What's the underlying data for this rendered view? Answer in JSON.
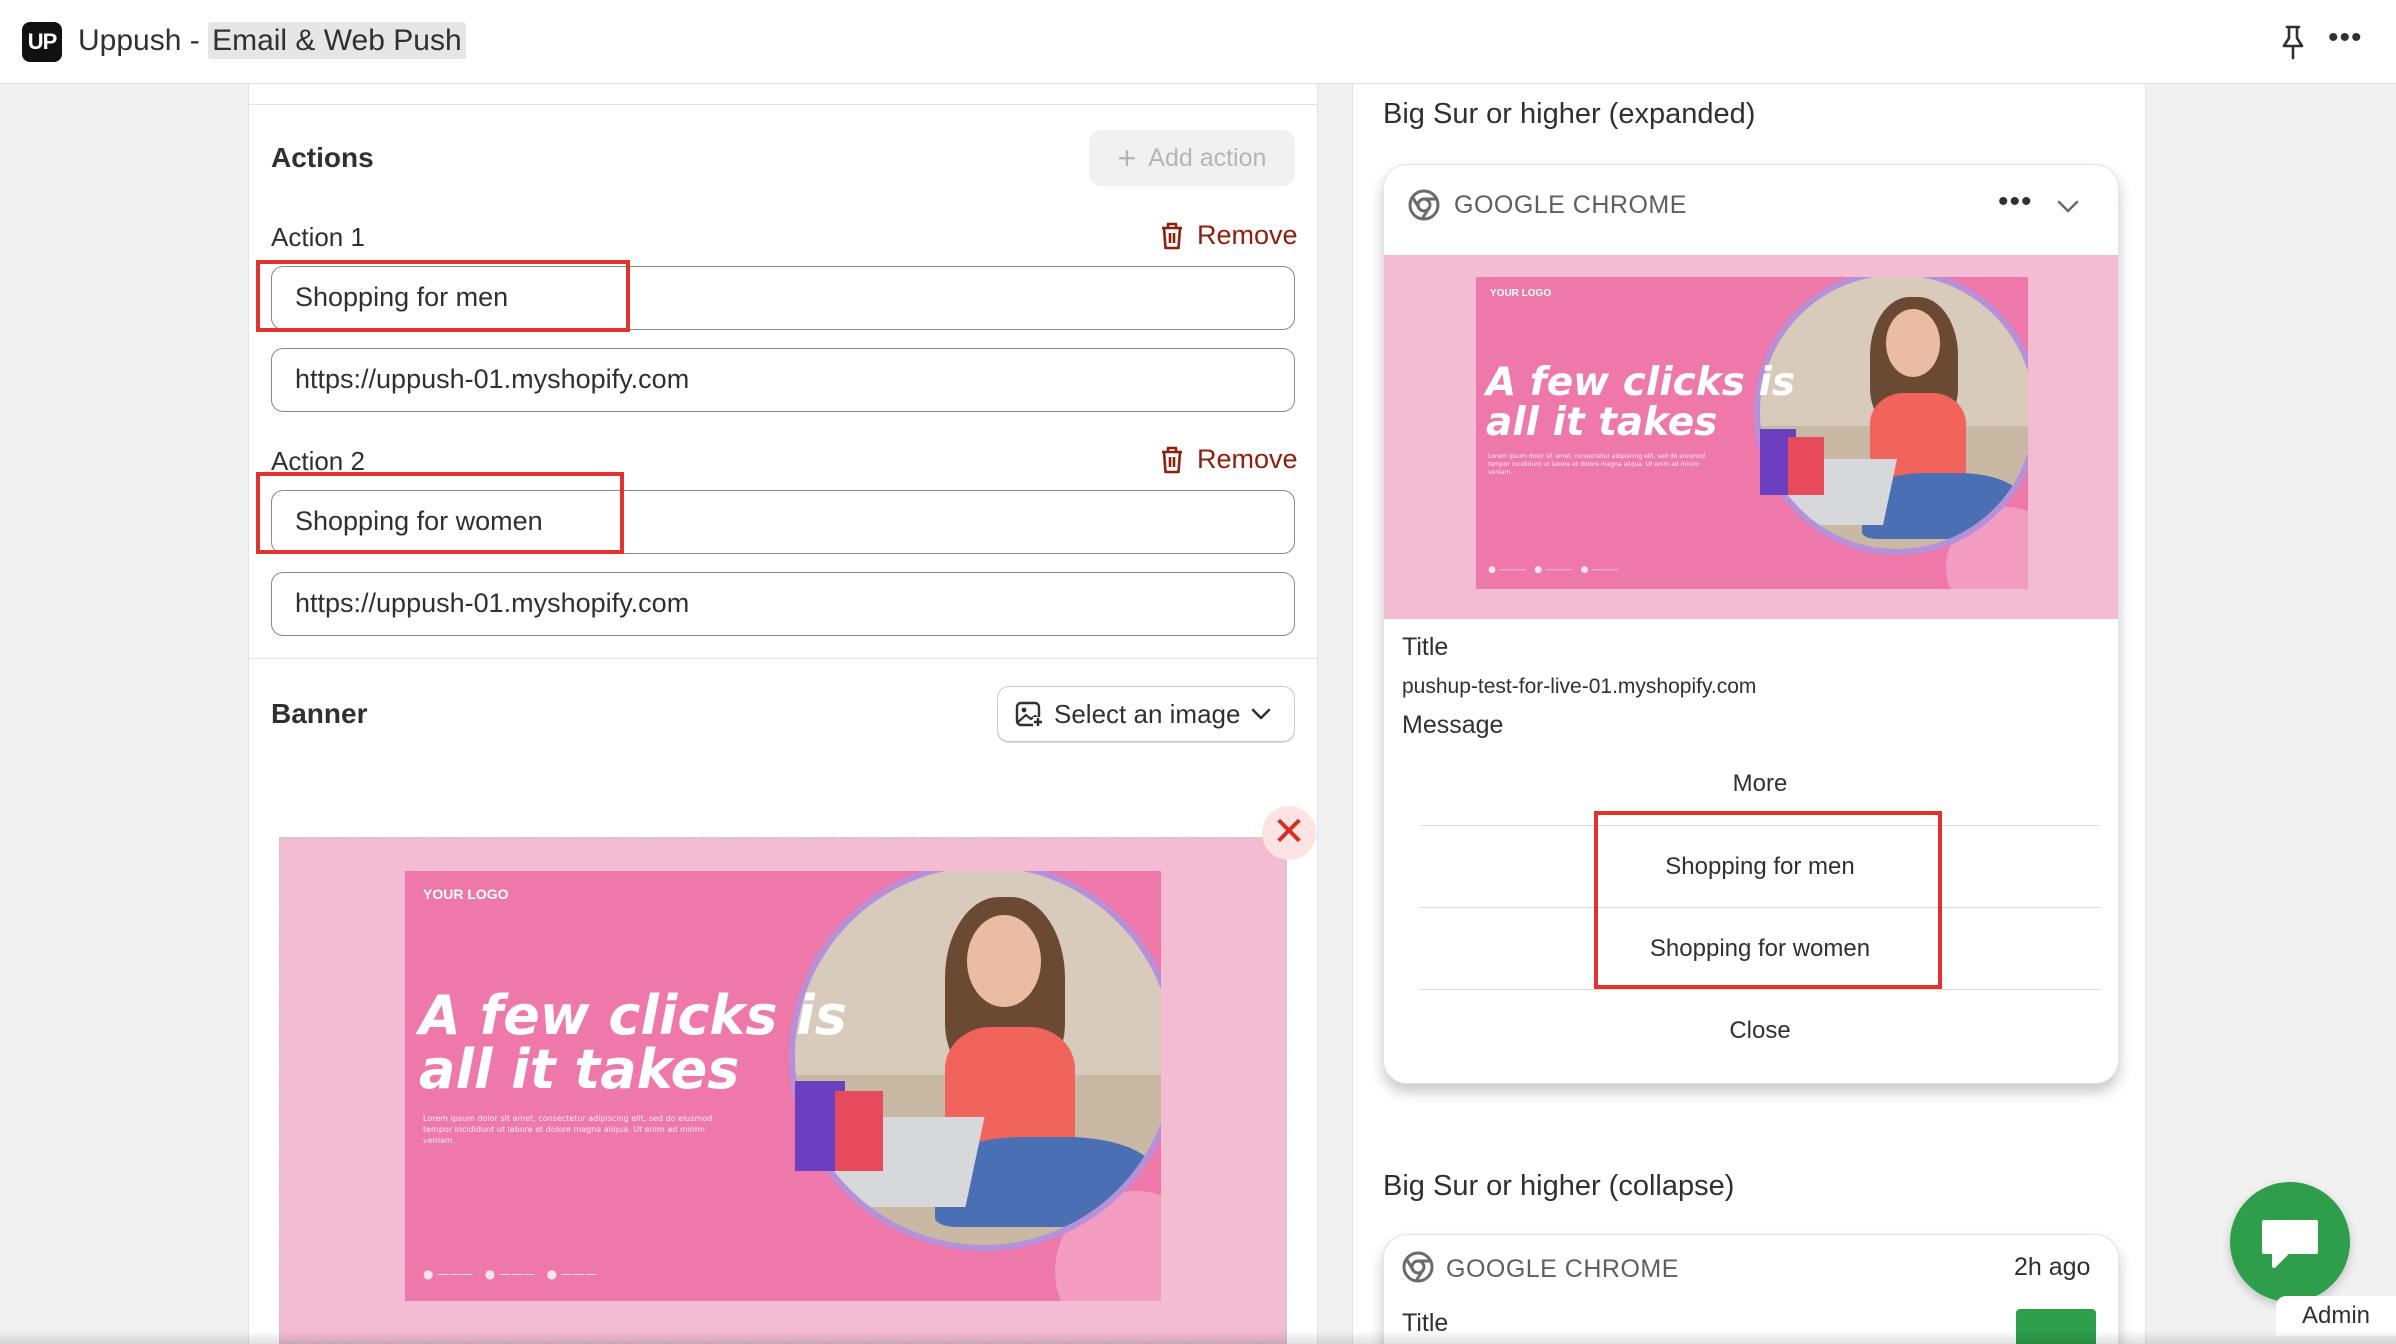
{
  "app": {
    "logo": "UP",
    "title": "Uppush",
    "separator": " - ",
    "subtitle": "Email & Web Push",
    "pin_icon": "pin-icon",
    "more_icon": "more-horizontal-icon",
    "more_glyph": "•••"
  },
  "actions": {
    "heading": "Actions",
    "add_button_label": "Add action",
    "add_icon": "+",
    "items": [
      {
        "label": "Action 1",
        "remove_label": "Remove",
        "title_value": "Shopping for men",
        "url_value": "https://uppush-01.myshopify.com"
      },
      {
        "label": "Action 2",
        "remove_label": "Remove",
        "title_value": "Shopping for women",
        "url_value": "https://uppush-01.myshopify.com"
      }
    ]
  },
  "banner": {
    "heading": "Banner",
    "select_label": "Select an image",
    "remove_glyph": "✕",
    "artwork": {
      "logo_text": "YOUR LOGO",
      "headline_line1": "A few clicks is",
      "headline_line2": "all it takes",
      "body_text": "Lorem ipsum dolor sit amet, consectetur adipiscing elit, sed do eiusmod tempor incididunt ut labore et dolore magna aliqua. Ut enim ad minim veniam."
    }
  },
  "preview_expanded": {
    "heading": "Big Sur or higher (expanded)",
    "browser": "GOOGLE CHROME",
    "dots_glyph": "•••",
    "title": "Title",
    "site": "pushup-test-for-live-01.myshopify.com",
    "message": "Message",
    "more": "More",
    "buttons": [
      "Shopping for men",
      "Shopping for women"
    ],
    "close": "Close"
  },
  "preview_collapse": {
    "heading": "Big Sur or higher (collapse)",
    "browser": "GOOGLE CHROME",
    "time_ago": "2h ago",
    "title": "Title"
  },
  "chat": {
    "admin_label": "Admin"
  },
  "colors": {
    "highlight_red": "#e0332b",
    "remove_red": "#8e1f0b",
    "chat_green": "#2e9e4b",
    "banner_pink": "#ee78a9"
  }
}
